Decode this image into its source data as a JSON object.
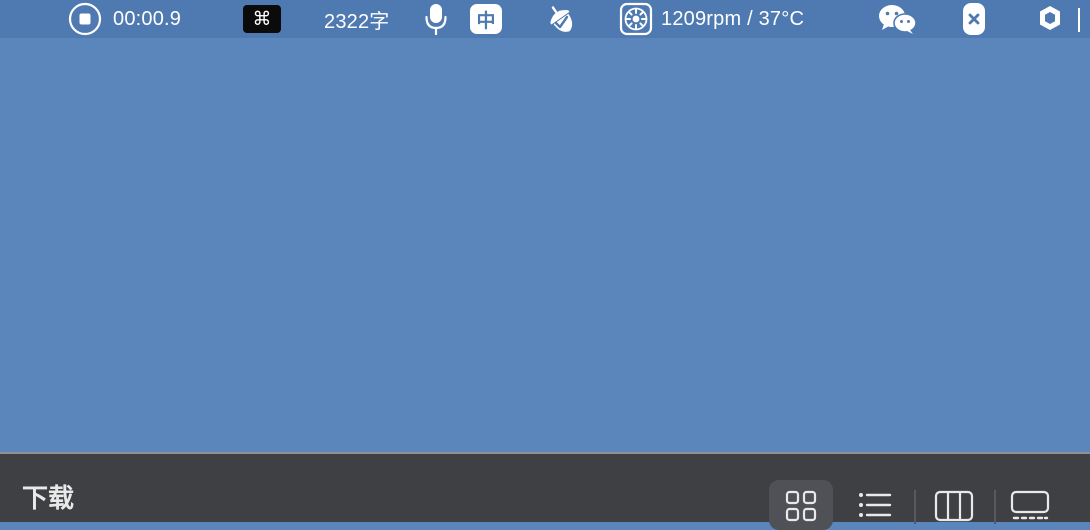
{
  "menubar": {
    "recorder": {
      "icon": "stop-record-icon",
      "time": "00:00.9"
    },
    "command_key": {
      "glyph": "⌘"
    },
    "word_count": "2322字",
    "microphone": {
      "icon": "microphone-icon"
    },
    "input_method": {
      "label": "中"
    },
    "acorn": {
      "icon": "acorn-icon"
    },
    "fan_monitor": {
      "icon": "fan-icon",
      "reading": "1209rpm / 37°C"
    },
    "wechat": {
      "icon": "wechat-icon"
    },
    "close_app": {
      "icon": "close-x-icon"
    },
    "hexagon_app": {
      "icon": "hexagon-icon"
    }
  },
  "panel": {
    "title": "下载",
    "view_modes": [
      {
        "name": "icon-grid-view",
        "active": true
      },
      {
        "name": "list-view",
        "active": false
      },
      {
        "name": "column-view",
        "active": false
      },
      {
        "name": "gallery-view",
        "active": false
      }
    ]
  },
  "colors": {
    "menubar_bg": "#4f7ab1",
    "desktop_bg": "#5a86bc",
    "panel_bg": "#3f4044",
    "panel_active_btn": "#505157",
    "icon_fg": "#e9e9ea"
  }
}
